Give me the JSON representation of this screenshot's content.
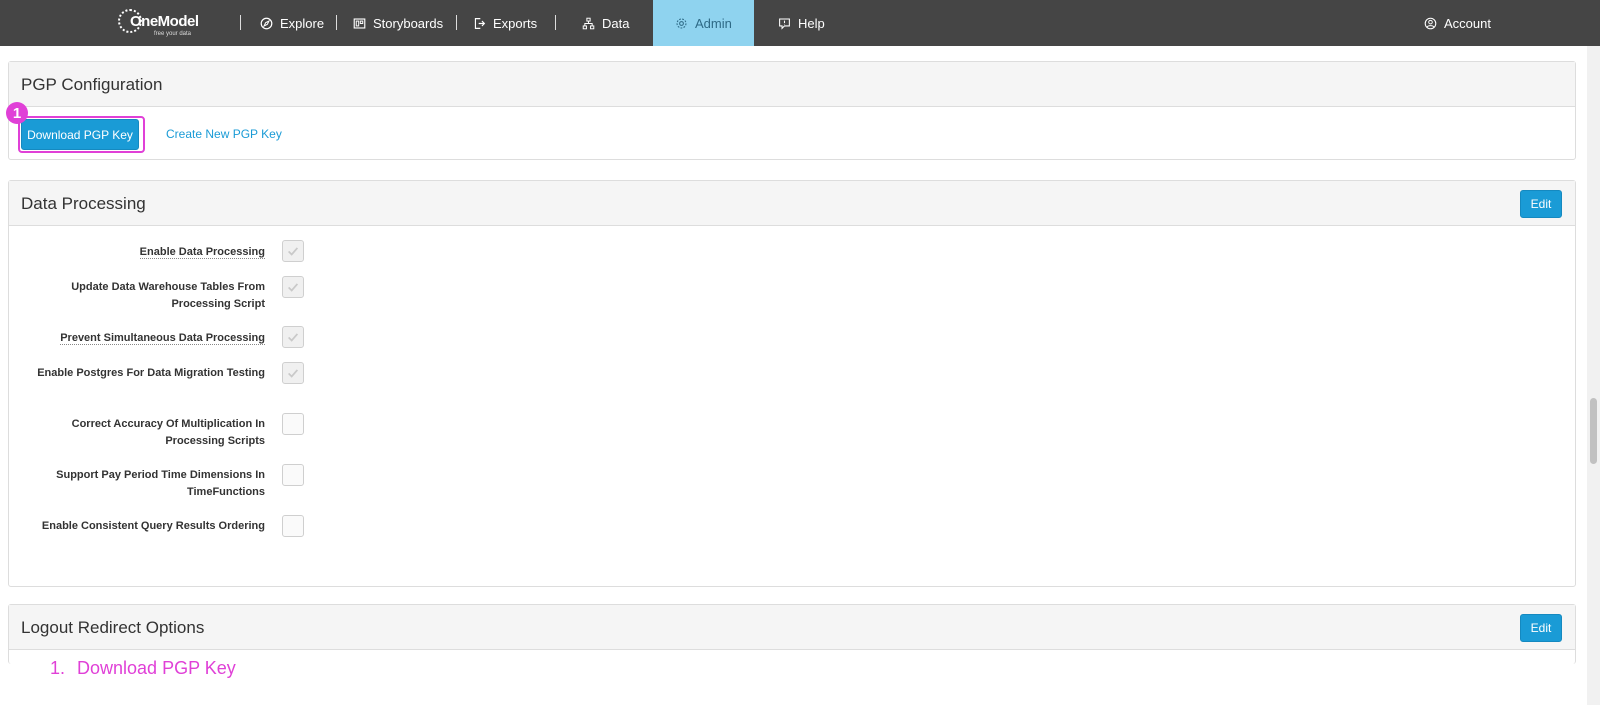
{
  "nav": {
    "logo_brand": "OneModel",
    "logo_tagline": "free your data",
    "items": [
      {
        "label": "Explore",
        "icon": "compass-icon"
      },
      {
        "label": "Storyboards",
        "icon": "storyboard-icon"
      },
      {
        "label": "Exports",
        "icon": "export-icon"
      },
      {
        "label": "Data",
        "icon": "hierarchy-icon"
      },
      {
        "label": "Admin",
        "icon": "gear-icon",
        "active": true
      },
      {
        "label": "Help",
        "icon": "help-bubble-icon"
      }
    ],
    "account_label": "Account"
  },
  "pgp": {
    "title": "PGP Configuration",
    "download_label": "Download PGP Key",
    "create_label": "Create New PGP Key",
    "step_number": "1"
  },
  "data_processing": {
    "title": "Data Processing",
    "edit_label": "Edit",
    "rows": [
      {
        "label": "Enable Data Processing",
        "checked": true
      },
      {
        "label": "Update Data Warehouse Tables From Processing Script",
        "checked": true
      },
      {
        "label": "Prevent Simultaneous Data Processing",
        "checked": true
      },
      {
        "label": "Enable Postgres For Data Migration Testing",
        "checked": true
      },
      {
        "label": "Correct Accuracy Of Multiplication In Processing Scripts",
        "checked": false
      },
      {
        "label": "Support Pay Period Time Dimensions In TimeFunctions",
        "checked": false
      },
      {
        "label": "Enable Consistent Query Results Ordering",
        "checked": false
      }
    ]
  },
  "logout": {
    "title": "Logout Redirect Options",
    "edit_label": "Edit"
  },
  "caption": {
    "number": "1.",
    "text": "Download PGP Key"
  },
  "colors": {
    "accent": "#1a9bd6",
    "highlight": "#e040d7",
    "nav_bg": "#454545",
    "nav_active": "#8fd3ef"
  }
}
